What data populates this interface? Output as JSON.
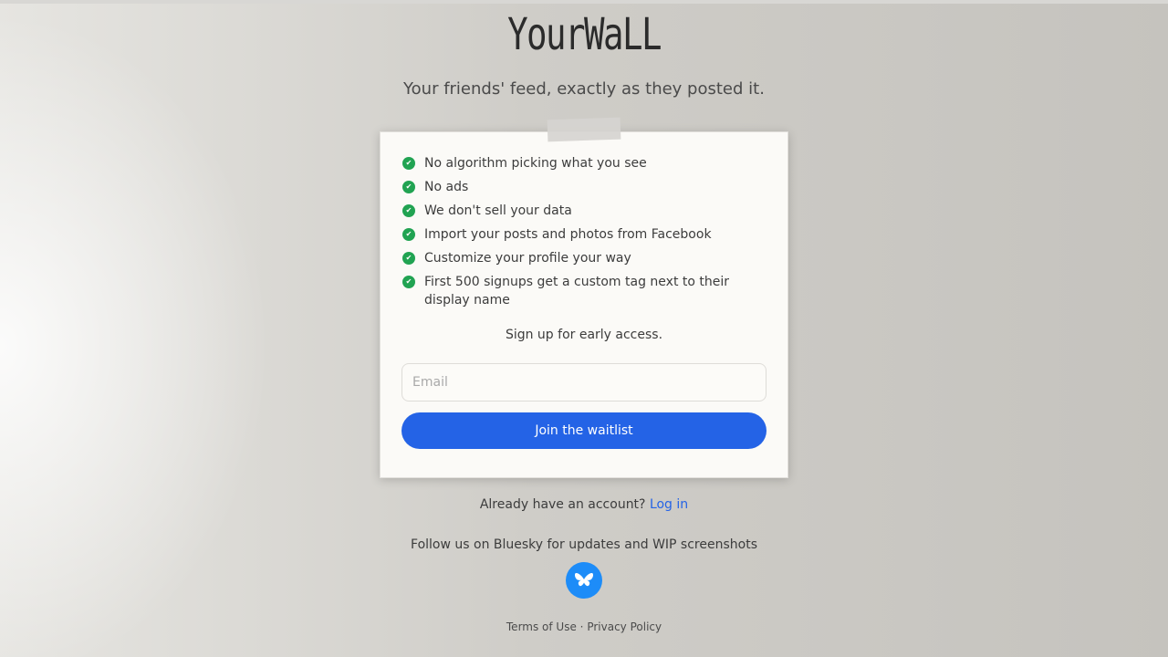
{
  "brand": {
    "logo_text": "YourWaLL",
    "tagline": "Your friends' feed, exactly as they posted it."
  },
  "features": [
    "No algorithm picking what you see",
    "No ads",
    "We don't sell your data",
    "Import your posts and photos from Facebook",
    "Customize your profile your way",
    "First 500 signups get a custom tag next to their display name"
  ],
  "signup": {
    "hint": "Sign up for early access.",
    "email_placeholder": "Email",
    "email_value": "",
    "button_label": "Join the waitlist"
  },
  "login": {
    "prompt": "Already have an account?",
    "link_label": "Log in"
  },
  "social": {
    "follow_text": "Follow us on Bluesky for updates and WIP screenshots",
    "icon": "bluesky-butterfly-icon"
  },
  "footer": {
    "terms": "Terms of Use",
    "separator": "·",
    "privacy": "Privacy Policy"
  },
  "colors": {
    "accent": "#2463e6",
    "check": "#21a352",
    "bluesky": "#1d8cf8"
  }
}
